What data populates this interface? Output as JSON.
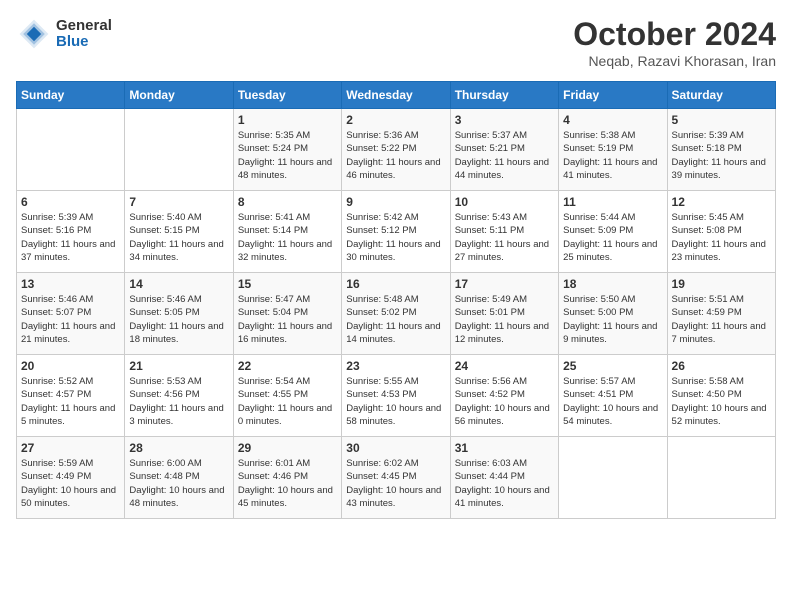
{
  "logo": {
    "general": "General",
    "blue": "Blue"
  },
  "title": "October 2024",
  "subtitle": "Neqab, Razavi Khorasan, Iran",
  "weekdays": [
    "Sunday",
    "Monday",
    "Tuesday",
    "Wednesday",
    "Thursday",
    "Friday",
    "Saturday"
  ],
  "weeks": [
    [
      {
        "day": "",
        "sunrise": "",
        "sunset": "",
        "daylight": ""
      },
      {
        "day": "",
        "sunrise": "",
        "sunset": "",
        "daylight": ""
      },
      {
        "day": "1",
        "sunrise": "Sunrise: 5:35 AM",
        "sunset": "Sunset: 5:24 PM",
        "daylight": "Daylight: 11 hours and 48 minutes."
      },
      {
        "day": "2",
        "sunrise": "Sunrise: 5:36 AM",
        "sunset": "Sunset: 5:22 PM",
        "daylight": "Daylight: 11 hours and 46 minutes."
      },
      {
        "day": "3",
        "sunrise": "Sunrise: 5:37 AM",
        "sunset": "Sunset: 5:21 PM",
        "daylight": "Daylight: 11 hours and 44 minutes."
      },
      {
        "day": "4",
        "sunrise": "Sunrise: 5:38 AM",
        "sunset": "Sunset: 5:19 PM",
        "daylight": "Daylight: 11 hours and 41 minutes."
      },
      {
        "day": "5",
        "sunrise": "Sunrise: 5:39 AM",
        "sunset": "Sunset: 5:18 PM",
        "daylight": "Daylight: 11 hours and 39 minutes."
      }
    ],
    [
      {
        "day": "6",
        "sunrise": "Sunrise: 5:39 AM",
        "sunset": "Sunset: 5:16 PM",
        "daylight": "Daylight: 11 hours and 37 minutes."
      },
      {
        "day": "7",
        "sunrise": "Sunrise: 5:40 AM",
        "sunset": "Sunset: 5:15 PM",
        "daylight": "Daylight: 11 hours and 34 minutes."
      },
      {
        "day": "8",
        "sunrise": "Sunrise: 5:41 AM",
        "sunset": "Sunset: 5:14 PM",
        "daylight": "Daylight: 11 hours and 32 minutes."
      },
      {
        "day": "9",
        "sunrise": "Sunrise: 5:42 AM",
        "sunset": "Sunset: 5:12 PM",
        "daylight": "Daylight: 11 hours and 30 minutes."
      },
      {
        "day": "10",
        "sunrise": "Sunrise: 5:43 AM",
        "sunset": "Sunset: 5:11 PM",
        "daylight": "Daylight: 11 hours and 27 minutes."
      },
      {
        "day": "11",
        "sunrise": "Sunrise: 5:44 AM",
        "sunset": "Sunset: 5:09 PM",
        "daylight": "Daylight: 11 hours and 25 minutes."
      },
      {
        "day": "12",
        "sunrise": "Sunrise: 5:45 AM",
        "sunset": "Sunset: 5:08 PM",
        "daylight": "Daylight: 11 hours and 23 minutes."
      }
    ],
    [
      {
        "day": "13",
        "sunrise": "Sunrise: 5:46 AM",
        "sunset": "Sunset: 5:07 PM",
        "daylight": "Daylight: 11 hours and 21 minutes."
      },
      {
        "day": "14",
        "sunrise": "Sunrise: 5:46 AM",
        "sunset": "Sunset: 5:05 PM",
        "daylight": "Daylight: 11 hours and 18 minutes."
      },
      {
        "day": "15",
        "sunrise": "Sunrise: 5:47 AM",
        "sunset": "Sunset: 5:04 PM",
        "daylight": "Daylight: 11 hours and 16 minutes."
      },
      {
        "day": "16",
        "sunrise": "Sunrise: 5:48 AM",
        "sunset": "Sunset: 5:02 PM",
        "daylight": "Daylight: 11 hours and 14 minutes."
      },
      {
        "day": "17",
        "sunrise": "Sunrise: 5:49 AM",
        "sunset": "Sunset: 5:01 PM",
        "daylight": "Daylight: 11 hours and 12 minutes."
      },
      {
        "day": "18",
        "sunrise": "Sunrise: 5:50 AM",
        "sunset": "Sunset: 5:00 PM",
        "daylight": "Daylight: 11 hours and 9 minutes."
      },
      {
        "day": "19",
        "sunrise": "Sunrise: 5:51 AM",
        "sunset": "Sunset: 4:59 PM",
        "daylight": "Daylight: 11 hours and 7 minutes."
      }
    ],
    [
      {
        "day": "20",
        "sunrise": "Sunrise: 5:52 AM",
        "sunset": "Sunset: 4:57 PM",
        "daylight": "Daylight: 11 hours and 5 minutes."
      },
      {
        "day": "21",
        "sunrise": "Sunrise: 5:53 AM",
        "sunset": "Sunset: 4:56 PM",
        "daylight": "Daylight: 11 hours and 3 minutes."
      },
      {
        "day": "22",
        "sunrise": "Sunrise: 5:54 AM",
        "sunset": "Sunset: 4:55 PM",
        "daylight": "Daylight: 11 hours and 0 minutes."
      },
      {
        "day": "23",
        "sunrise": "Sunrise: 5:55 AM",
        "sunset": "Sunset: 4:53 PM",
        "daylight": "Daylight: 10 hours and 58 minutes."
      },
      {
        "day": "24",
        "sunrise": "Sunrise: 5:56 AM",
        "sunset": "Sunset: 4:52 PM",
        "daylight": "Daylight: 10 hours and 56 minutes."
      },
      {
        "day": "25",
        "sunrise": "Sunrise: 5:57 AM",
        "sunset": "Sunset: 4:51 PM",
        "daylight": "Daylight: 10 hours and 54 minutes."
      },
      {
        "day": "26",
        "sunrise": "Sunrise: 5:58 AM",
        "sunset": "Sunset: 4:50 PM",
        "daylight": "Daylight: 10 hours and 52 minutes."
      }
    ],
    [
      {
        "day": "27",
        "sunrise": "Sunrise: 5:59 AM",
        "sunset": "Sunset: 4:49 PM",
        "daylight": "Daylight: 10 hours and 50 minutes."
      },
      {
        "day": "28",
        "sunrise": "Sunrise: 6:00 AM",
        "sunset": "Sunset: 4:48 PM",
        "daylight": "Daylight: 10 hours and 48 minutes."
      },
      {
        "day": "29",
        "sunrise": "Sunrise: 6:01 AM",
        "sunset": "Sunset: 4:46 PM",
        "daylight": "Daylight: 10 hours and 45 minutes."
      },
      {
        "day": "30",
        "sunrise": "Sunrise: 6:02 AM",
        "sunset": "Sunset: 4:45 PM",
        "daylight": "Daylight: 10 hours and 43 minutes."
      },
      {
        "day": "31",
        "sunrise": "Sunrise: 6:03 AM",
        "sunset": "Sunset: 4:44 PM",
        "daylight": "Daylight: 10 hours and 41 minutes."
      },
      {
        "day": "",
        "sunrise": "",
        "sunset": "",
        "daylight": ""
      },
      {
        "day": "",
        "sunrise": "",
        "sunset": "",
        "daylight": ""
      }
    ]
  ]
}
